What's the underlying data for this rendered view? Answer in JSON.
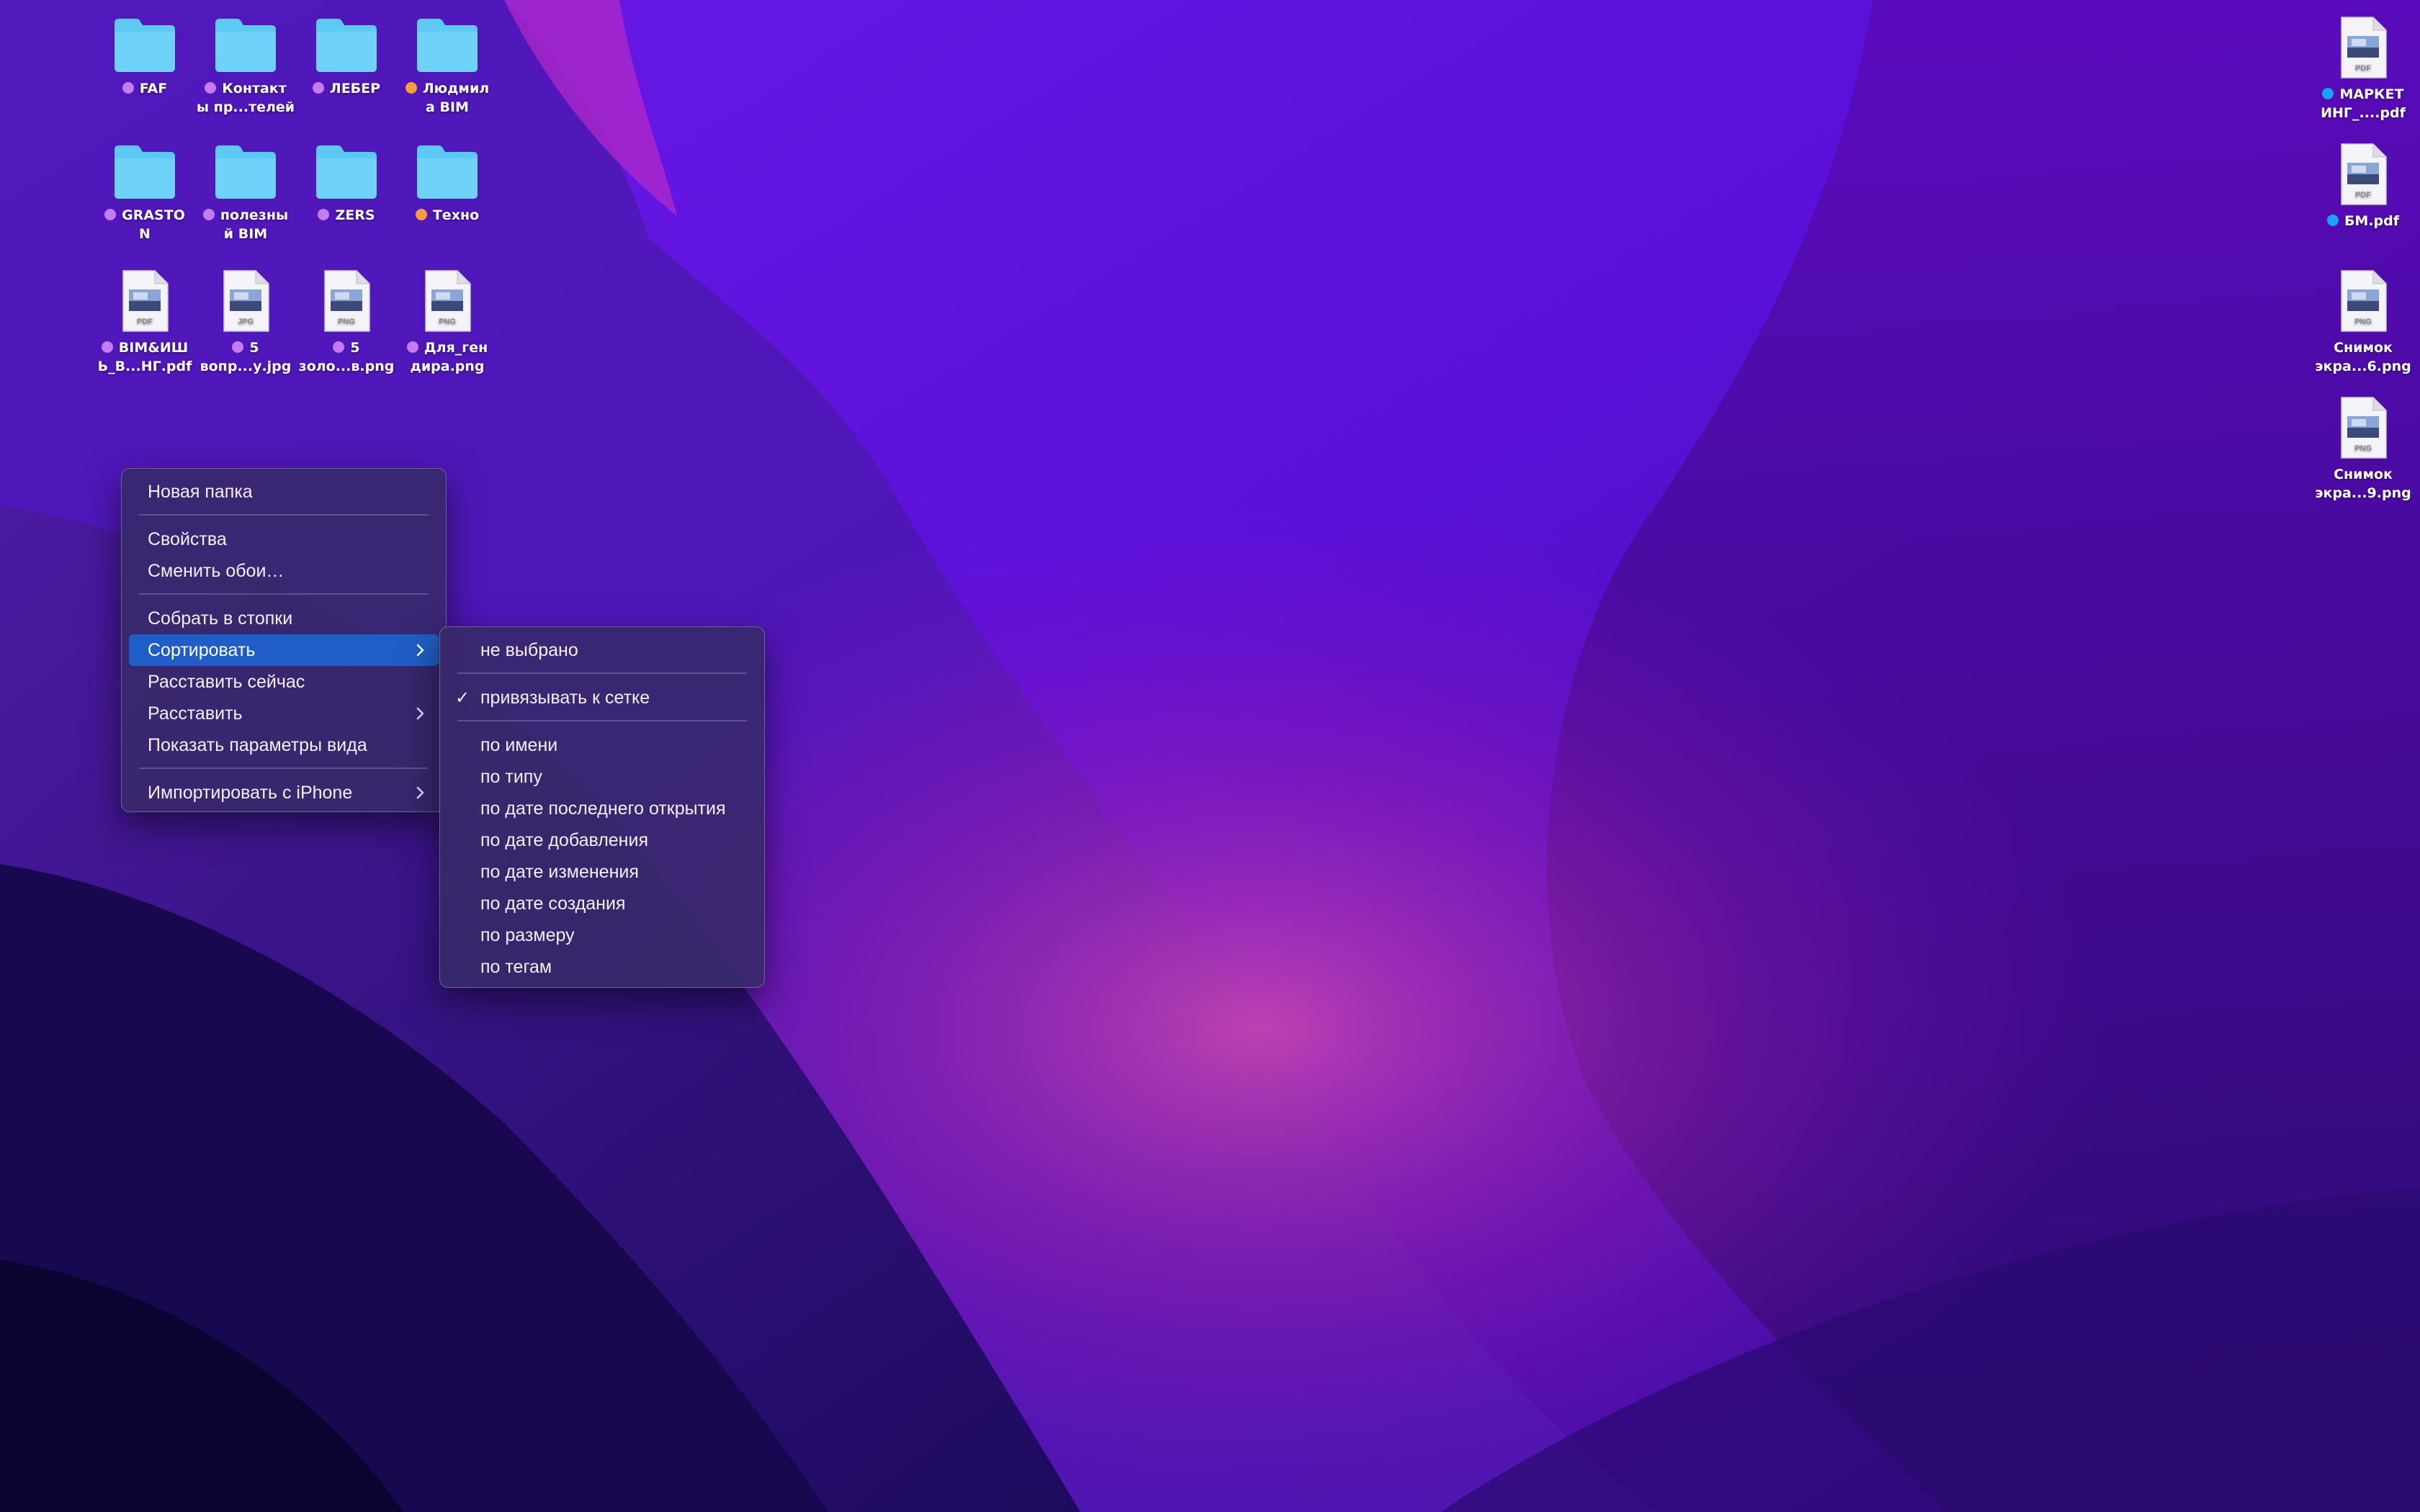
{
  "colors": {
    "tag_purple": "#c57cf0",
    "tag_orange": "#f5a03c",
    "tag_blue": "#1aa3f5",
    "folder": "#5ccaf5",
    "menu_highlight": "#1f5ec6"
  },
  "desktop": {
    "icons": [
      {
        "label": "FAF",
        "kind": "folder",
        "tag": "purple"
      },
      {
        "label": "Контакт\nы пр...телей",
        "kind": "folder",
        "tag": "purple"
      },
      {
        "label": "ЛЕБЕР",
        "kind": "folder",
        "tag": "purple"
      },
      {
        "label": "Людмил\nа BIM",
        "kind": "folder",
        "tag": "orange"
      },
      {
        "label": "GRASTO\nN",
        "kind": "folder",
        "tag": "purple"
      },
      {
        "label": "полезны\nй BIM",
        "kind": "folder",
        "tag": "purple"
      },
      {
        "label": "ZERS",
        "kind": "folder",
        "tag": "purple"
      },
      {
        "label": "Техно",
        "kind": "folder",
        "tag": "orange"
      },
      {
        "label": "BIM&ИШ\nЬ_В...НГ.pdf",
        "kind": "file",
        "ext": "PDF",
        "tag": "purple"
      },
      {
        "label": "5\nвопр...у.jpg",
        "kind": "file",
        "ext": "JPG",
        "tag": "purple"
      },
      {
        "label": "5\nзоло...в.png",
        "kind": "file",
        "ext": "PNG",
        "tag": "purple"
      },
      {
        "label": "Для_ген\nдира.png",
        "kind": "file",
        "ext": "PNG",
        "tag": "purple"
      },
      {
        "label": "МАРКЕТ\nИНГ_....pdf",
        "kind": "file",
        "ext": "PDF",
        "tag": "blue"
      },
      {
        "label": "БМ.pdf",
        "kind": "file",
        "ext": "PDF",
        "tag": "blue"
      },
      {
        "label": "Снимок\nэкра...6.png",
        "kind": "file",
        "ext": "PNG",
        "tag": null
      },
      {
        "label": "Снимок\nэкра...9.png",
        "kind": "file",
        "ext": "PNG",
        "tag": null
      }
    ]
  },
  "context_menu": {
    "new_folder": "Новая папка",
    "properties": "Свойства",
    "change_wallpaper": "Сменить обои…",
    "use_stacks": "Собрать в стопки",
    "sort_by": "Сортировать",
    "clean_up": "Расставить сейчас",
    "clean_up_by": "Расставить",
    "show_view_options": "Показать параметры вида",
    "import_from_iphone": "Импортировать с iPhone"
  },
  "sort_submenu": {
    "none": "не выбрано",
    "snap_to_grid": "привязывать к сетке",
    "snap_checked": true,
    "check_glyph": "✓",
    "items": [
      "по имени",
      "по типу",
      "по дате последнего открытия",
      "по дате добавления",
      "по дате изменения",
      "по дате создания",
      "по размеру",
      "по тегам"
    ]
  }
}
